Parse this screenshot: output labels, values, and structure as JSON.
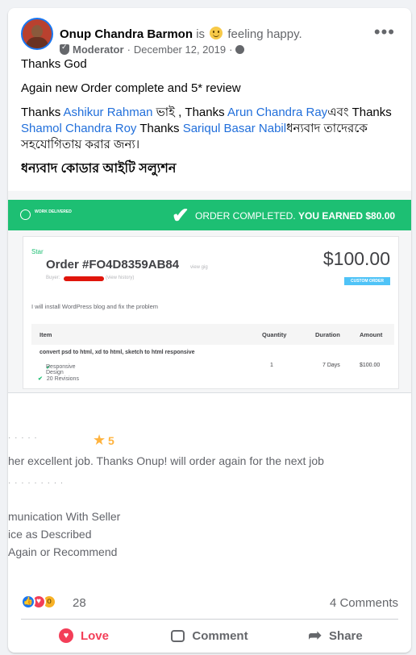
{
  "post": {
    "author": "Onup Chandra Barmon",
    "feeling_prefix": "is",
    "feeling_icon": "smile-emoji",
    "feeling": "feeling happy.",
    "role": "Moderator",
    "date": "December 12, 2019",
    "separator": "·",
    "more_icon": "more-dots-icon",
    "privacy_icon": "globe-icon"
  },
  "text": {
    "line1": "Thanks God",
    "line2": "Again new Order complete and 5* review",
    "p3": {
      "t1": "Thanks ",
      "l1": "Ashikur Rahman",
      "t2": " ভাই , Thanks ",
      "l2": "Arun Chandra Ray",
      "t3": "এবং Thanks ",
      "l3": "Shamol Chandra Roy",
      "t4": " Thanks ",
      "l4": "Sariqul Basar Nabil",
      "t5": "ধন্যবাদ তাদেরকে সহযোগিতায় করার জন্য।"
    },
    "bold_line": "ধন্যবাদ কোডার আইটি সল্যুশন"
  },
  "screenshot": {
    "banner_left": "WORK DELIVERED",
    "banner_msg": "ORDER COMPLETED.",
    "banner_earned": "YOU EARNED $80.00",
    "star_label": "Star",
    "order_number": "Order #FO4D8359AB84",
    "view_gig": "view gig",
    "buyer_label": "Buyer:",
    "view_history": "(view history)",
    "price": "$100.00",
    "badge": "CUSTOM ORDER",
    "description": "I will install WordPress blog and fix the problem",
    "columns": {
      "item": "Item",
      "quantity": "Quantity",
      "duration": "Duration",
      "amount": "Amount"
    },
    "row": {
      "item": "convert psd to html, xd to html, sketch to html responsive",
      "quantity": "1",
      "duration": "7 Days",
      "amount": "$100.00"
    },
    "features": [
      "Responsive Design",
      "20 Revisions"
    ],
    "rating": "5",
    "review_text": "her excellent job. Thanks Onup! will order again for the next job",
    "criteria": [
      "munication With Seller",
      "ice as Described",
      "Again or Recommend"
    ]
  },
  "stats": {
    "reaction_count": "28",
    "comments": "4 Comments"
  },
  "actions": {
    "love": "Love",
    "comment": "Comment",
    "share": "Share"
  },
  "colors": {
    "fiverr_green": "#1dbf73",
    "link_blue": "#216fdb",
    "love_red": "#f33e58",
    "star_gold": "#ffb33e"
  }
}
